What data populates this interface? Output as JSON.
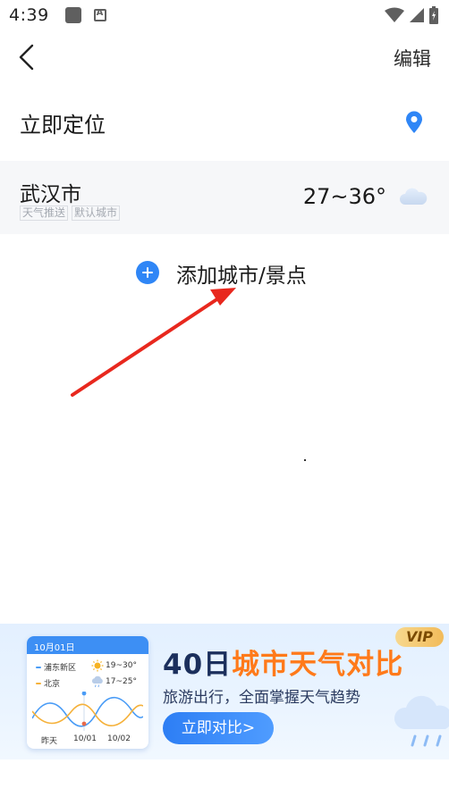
{
  "status_bar": {
    "time": "4:39",
    "icons": [
      "app-notification-icon",
      "a-box-icon",
      "wifi-icon",
      "signal-icon",
      "battery-icon"
    ]
  },
  "nav": {
    "back_icon": "chevron-left-icon",
    "edit_label": "编辑"
  },
  "locate": {
    "label": "立即定位",
    "icon": "location-pin-icon"
  },
  "city": {
    "name": "武汉市",
    "tags": [
      "天气推送",
      "默认城市"
    ],
    "temp": "27~36°",
    "weather_icon": "cloud-icon"
  },
  "add_city": {
    "label": "添加城市/景点",
    "icon": "plus-circle-icon"
  },
  "banner": {
    "card": {
      "date": "10月01日",
      "rows": [
        {
          "city": "浦东新区",
          "temp": "19~30°",
          "color": "#4a9cf6"
        },
        {
          "city": "北京",
          "temp": "17~25°",
          "color": "#f5b13a"
        }
      ],
      "x_labels": [
        "昨天",
        "10/01",
        "10/02"
      ]
    },
    "title_prefix": "40日",
    "title_highlight": "城市天气对比",
    "subtitle": "旅游出行，全面掌握天气趋势",
    "button_label": "立即对比>",
    "vip_label": "VIP"
  },
  "colors": {
    "accent": "#2f86f6",
    "annotation_arrow": "#e8281e",
    "highlight_orange": "#ff7a1a"
  }
}
